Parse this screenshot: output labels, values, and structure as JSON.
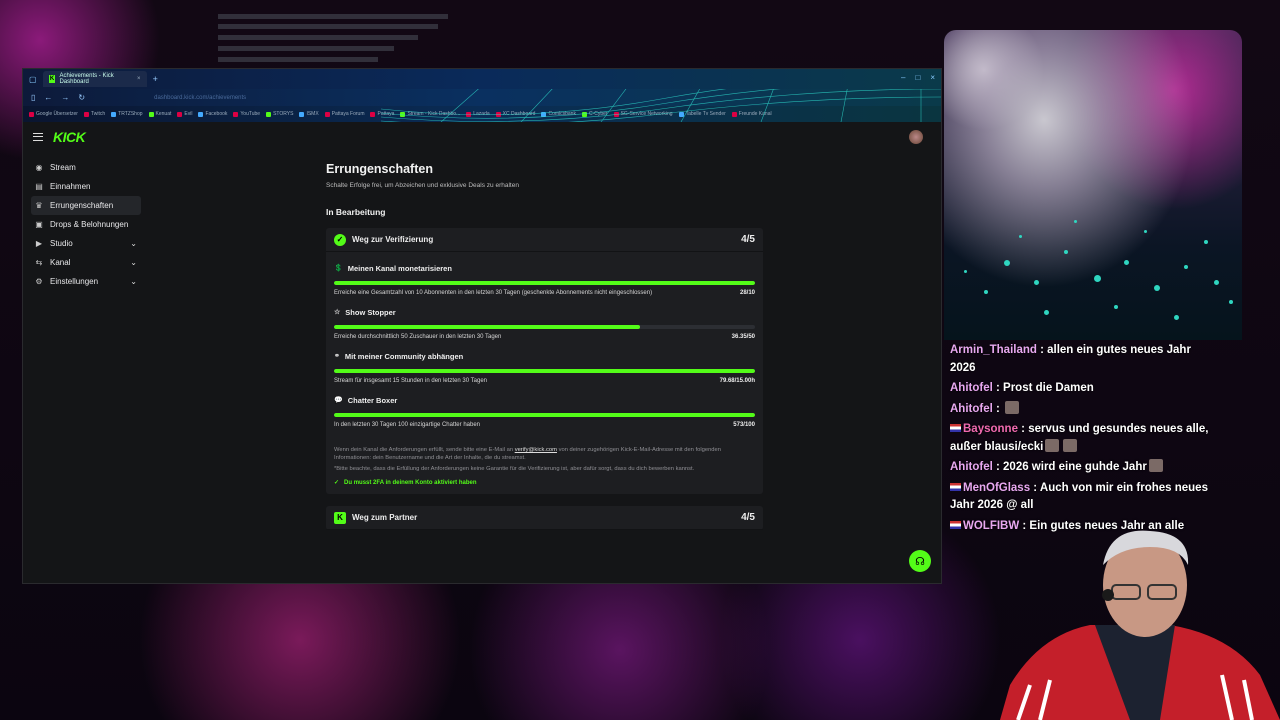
{
  "browser": {
    "tab_title": "Achievements - Kick Dashboard",
    "url": "dashboard.kick.com/achievements",
    "bookmarks": [
      "Google Übersetzer",
      "Twitch",
      "TRTZShop",
      "Kenuat",
      "Evil",
      "Facebook",
      "YouTube",
      "STORYS",
      "ISMX",
      "Pattaya Forum",
      "Pattaya",
      "Stream - Kick Dashbo...",
      "Lazada",
      "XC Dashboard",
      "Comicsbank",
      "C-Cyber",
      "SG-Service Networking",
      "Tabelle Tv Sender",
      "Freunde Kanal"
    ]
  },
  "sidebar": {
    "items": [
      {
        "label": "Stream",
        "icon": "broadcast-icon"
      },
      {
        "label": "Einnahmen",
        "icon": "wallet-icon"
      },
      {
        "label": "Errungenschaften",
        "icon": "trophy-icon"
      },
      {
        "label": "Drops & Belohnungen",
        "icon": "gift-icon"
      },
      {
        "label": "Studio",
        "icon": "studio-icon"
      },
      {
        "label": "Kanal",
        "icon": "channel-icon"
      },
      {
        "label": "Einstellungen",
        "icon": "gear-icon"
      }
    ]
  },
  "main": {
    "title": "Errungenschaften",
    "subtitle": "Schalte Erfolge frei, um Abzeichen und exklusive Deals zu erhalten",
    "section": "In Bearbeitung",
    "card1": {
      "title": "Weg zur Verifizierung",
      "count": "4/5",
      "tasks": [
        {
          "title": "Meinen Kanal monetarisieren",
          "desc": "Erreiche eine Gesamtzahl von 10 Abonnenten in den letzten 30 Tagen (geschenkte Abonnements nicht eingeschlossen)",
          "value": "28/10",
          "progress": 1.0
        },
        {
          "title": "Show Stopper",
          "desc": "Erreiche durchschnittlich 50 Zuschauer in den letzten 30 Tagen",
          "value": "36.35/50",
          "progress": 0.727
        },
        {
          "title": "Mit meiner Community abhängen",
          "desc": "Stream für insgesamt 15 Stunden in den letzten 30 Tagen",
          "value": "79.68/15.00h",
          "progress": 1.0
        },
        {
          "title": "Chatter Boxer",
          "desc": "In den letzten 30 Tagen 100 einzigartige Chatter haben",
          "value": "573/100",
          "progress": 1.0
        }
      ],
      "note_a": "Wenn dein Kanal die Anforderungen erfüllt, sende bitte eine E-Mail an ",
      "note_email": "verify@kick.com",
      "note_b": " von deiner zugehörigen Kick-E-Mail-Adresse mit den folgenden Informationen: dein Benutzername und die Art der Inhalte, die du streamst.",
      "note2": "*Bitte beachte, dass die Erfüllung der Anforderungen keine Garantie für die Verifizierung ist, aber dafür sorgt, dass du dich bewerben kannst.",
      "requirement": "Du musst 2FA in deinem Konto aktiviert haben"
    },
    "card2": {
      "title": "Weg zum Partner",
      "count": "4/5"
    }
  },
  "chat": [
    {
      "user": "Armin_Thailand",
      "text": " : allen ein gutes neues Jahr 2026"
    },
    {
      "user": "Ahitofel",
      "text": " : Prost die Damen"
    },
    {
      "user": "Ahitofel",
      "text": " : "
    },
    {
      "user": "Baysonne",
      "text": " : servus und gesundes neues alle, außer blausi/ecki"
    },
    {
      "user": "Ahitofel",
      "text": " : 2026 wird eine guhde Jahr"
    },
    {
      "user": "MenOfGlass",
      "text": " : Auch von mir ein frohes neues Jahr 2026 @ all"
    },
    {
      "user": "WOLFIBW",
      "text": " : Ein gutes neues Jahr an alle"
    }
  ],
  "colors": {
    "accent": "#53fc18",
    "bg": "#141517",
    "card": "#1d1e21"
  }
}
